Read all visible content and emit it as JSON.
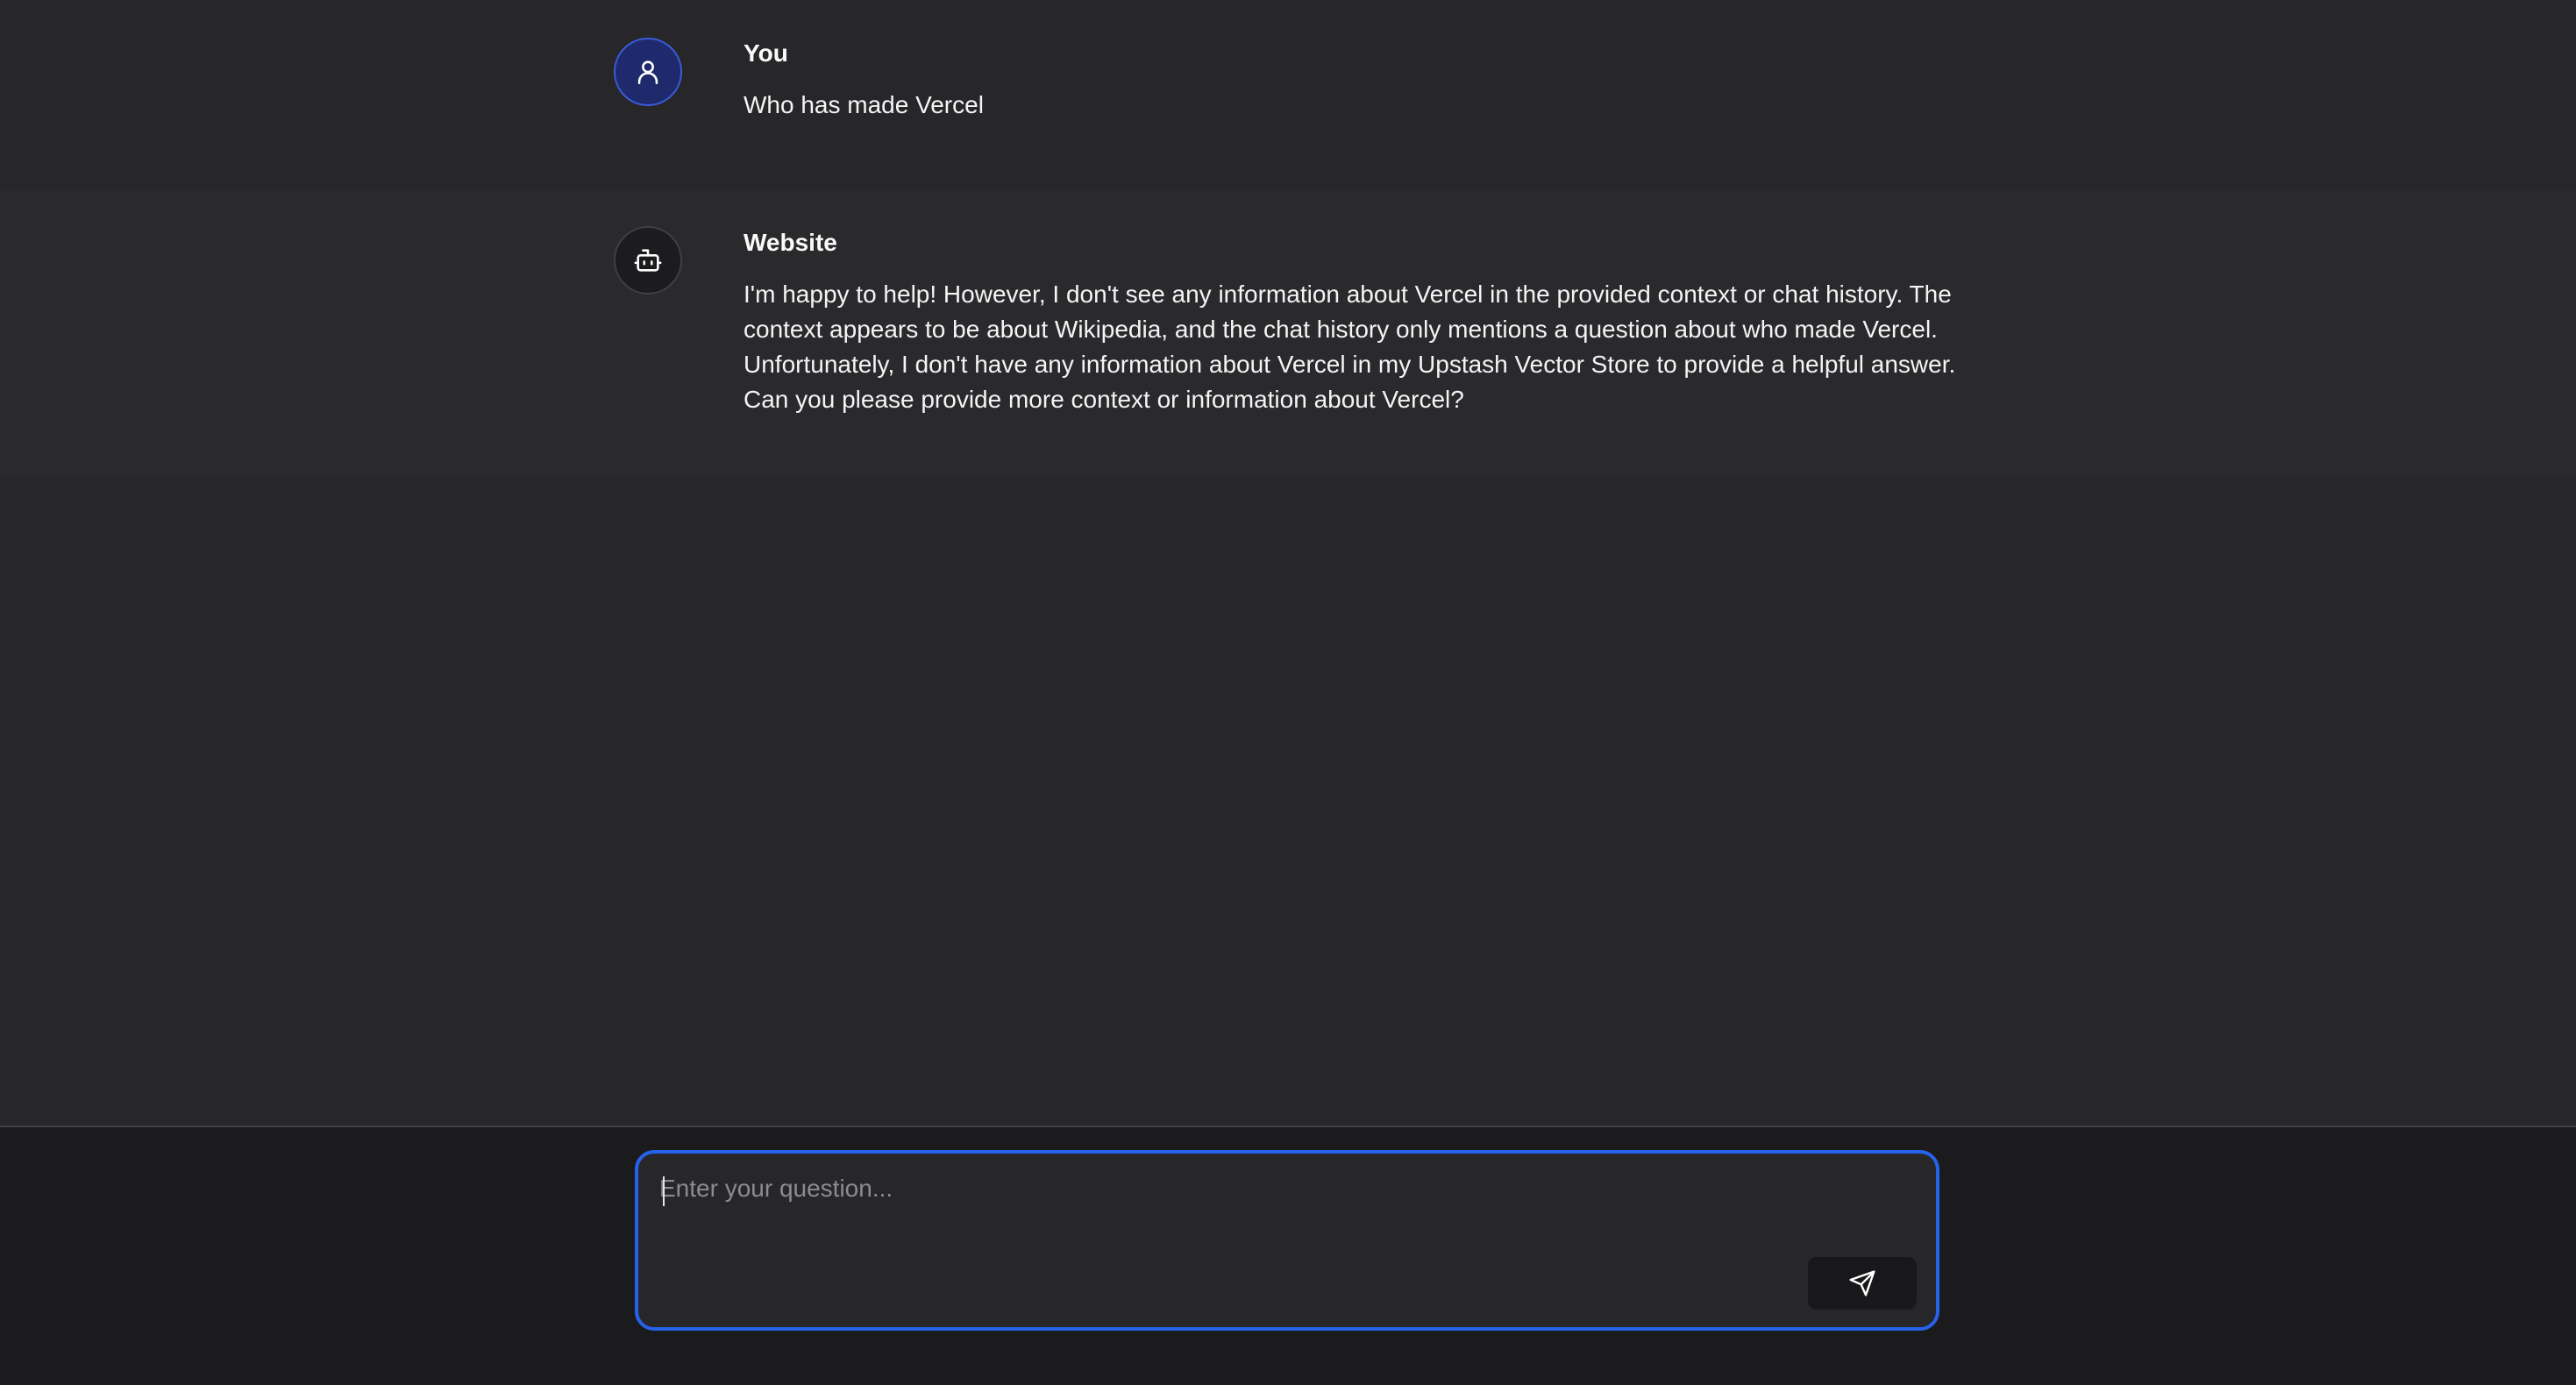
{
  "messages": [
    {
      "role": "user",
      "sender": "You",
      "icon": "user-icon",
      "text": "Who has made Vercel"
    },
    {
      "role": "assistant",
      "sender": "Website",
      "icon": "bot-icon",
      "text": "I'm happy to help! However, I don't see any information about Vercel in the provided context or chat history. The context appears to be about Wikipedia, and the chat history only mentions a question about who made Vercel. Unfortunately, I don't have any information about Vercel in my Upstash Vector Store to provide a helpful answer. Can you please provide more context or information about Vercel?"
    }
  ],
  "composer": {
    "placeholder": "Enter your question...",
    "value": "",
    "send_icon": "send-icon"
  },
  "colors": {
    "accent": "#2563eb",
    "user_avatar_bg": "#1e2a6b",
    "background": "#27272a"
  }
}
